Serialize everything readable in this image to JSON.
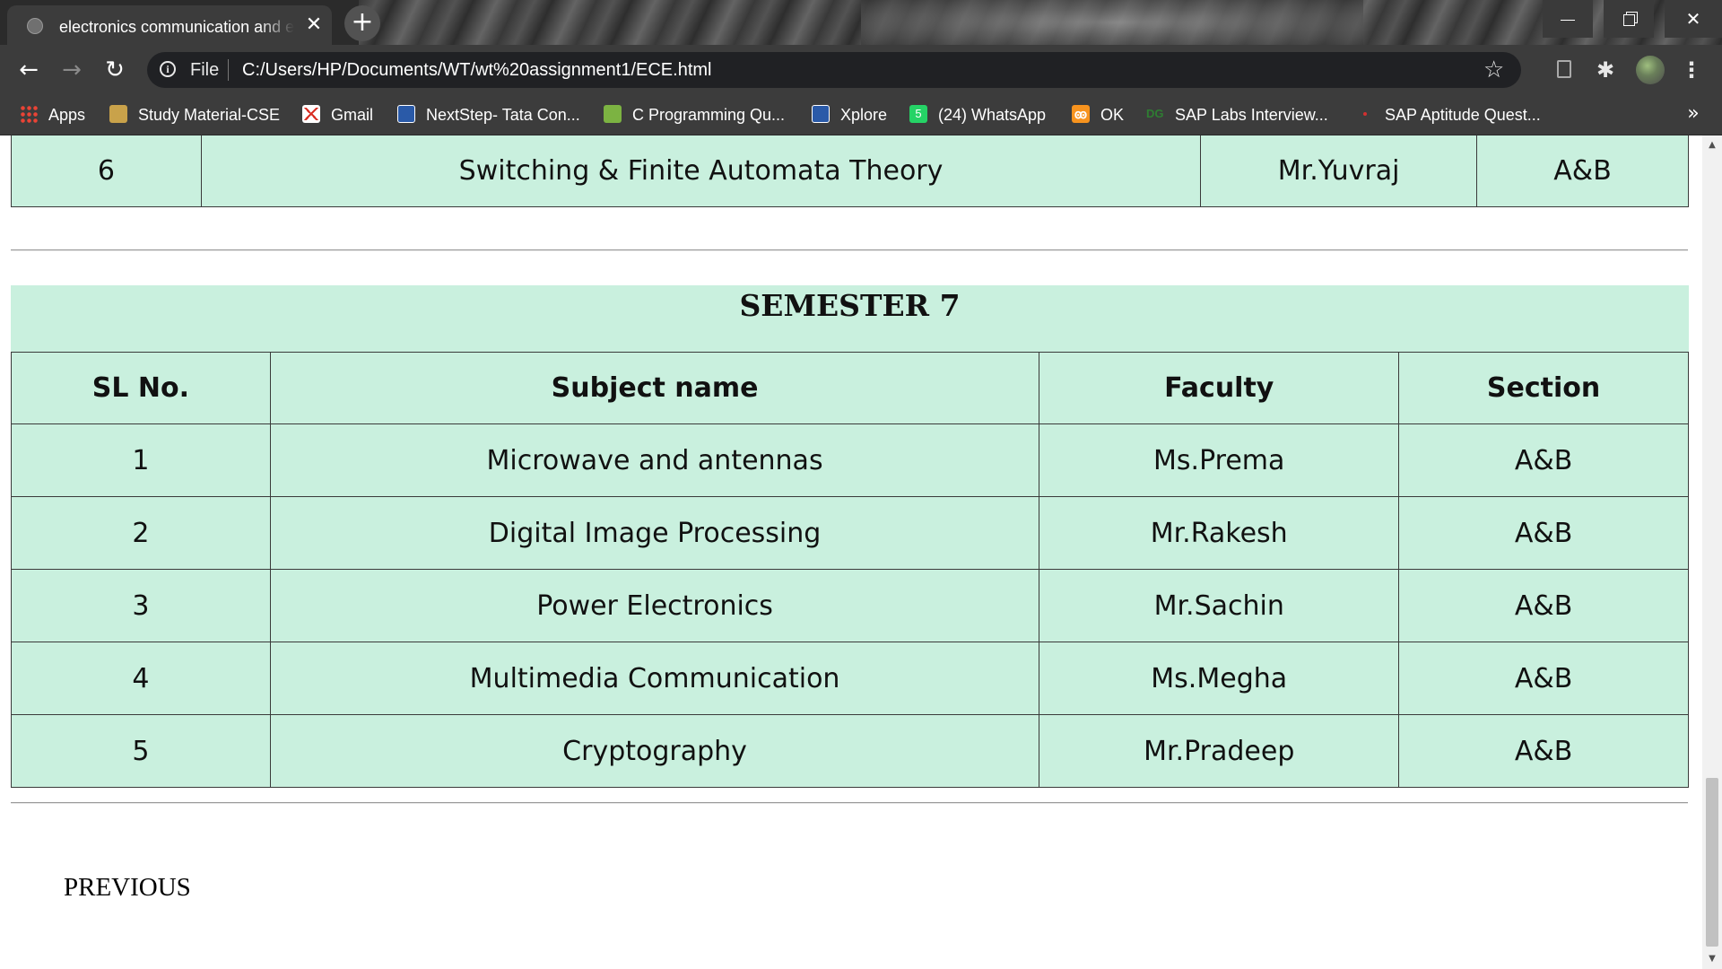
{
  "browser": {
    "tab_title": "electronics communication and engineering",
    "tab_close": "✕",
    "new_tab": "+",
    "url_scheme": "File",
    "url": "C:/Users/HP/Documents/WT/wt%20assignment1/ECE.html",
    "bookmarks": [
      {
        "label": "Apps",
        "icon": "apps-grid-icon"
      },
      {
        "label": "Study Material-CSE",
        "icon": "study-material-icon"
      },
      {
        "label": "Gmail",
        "icon": "gmail-icon"
      },
      {
        "label": "NextStep- Tata Con...",
        "icon": "tata-icon"
      },
      {
        "label": "C Programming Qu...",
        "icon": "leaf-icon"
      },
      {
        "label": "Xplore",
        "icon": "tata-icon"
      },
      {
        "label": "(24) WhatsApp",
        "icon": "whatsapp-icon",
        "badge": "5"
      },
      {
        "label": "OK",
        "icon": "ok-icon"
      },
      {
        "label": "SAP Labs Interview...",
        "icon": "dg-icon",
        "icon_text": "DG"
      },
      {
        "label": "SAP Aptitude Quest...",
        "icon": "red-dot-icon"
      }
    ],
    "bookmarks_more": "»"
  },
  "page": {
    "prev_table": {
      "row": {
        "sl": "6",
        "subject": "Switching & Finite Automata Theory",
        "faculty": "Mr.Yuvraj",
        "section": "A&B"
      }
    },
    "semester7": {
      "heading": "SEMESTER 7",
      "headers": {
        "sl": "SL No.",
        "subject": "Subject name",
        "faculty": "Faculty",
        "section": "Section"
      },
      "rows": [
        {
          "sl": "1",
          "subject": "Microwave and antennas",
          "faculty": "Ms.Prema",
          "section": "A&B"
        },
        {
          "sl": "2",
          "subject": "Digital Image Processing",
          "faculty": "Mr.Rakesh",
          "section": "A&B"
        },
        {
          "sl": "3",
          "subject": "Power Electronics",
          "faculty": "Mr.Sachin",
          "section": "A&B"
        },
        {
          "sl": "4",
          "subject": "Multimedia Communication",
          "faculty": "Ms.Megha",
          "section": "A&B"
        },
        {
          "sl": "5",
          "subject": "Cryptography",
          "faculty": "Mr.Pradeep",
          "section": "A&B"
        }
      ]
    },
    "previous_link": "PREVIOUS"
  },
  "colors": {
    "table_bg": "#c9f0de",
    "chrome_dark": "#3c3c3c",
    "omnibox": "#202124"
  }
}
